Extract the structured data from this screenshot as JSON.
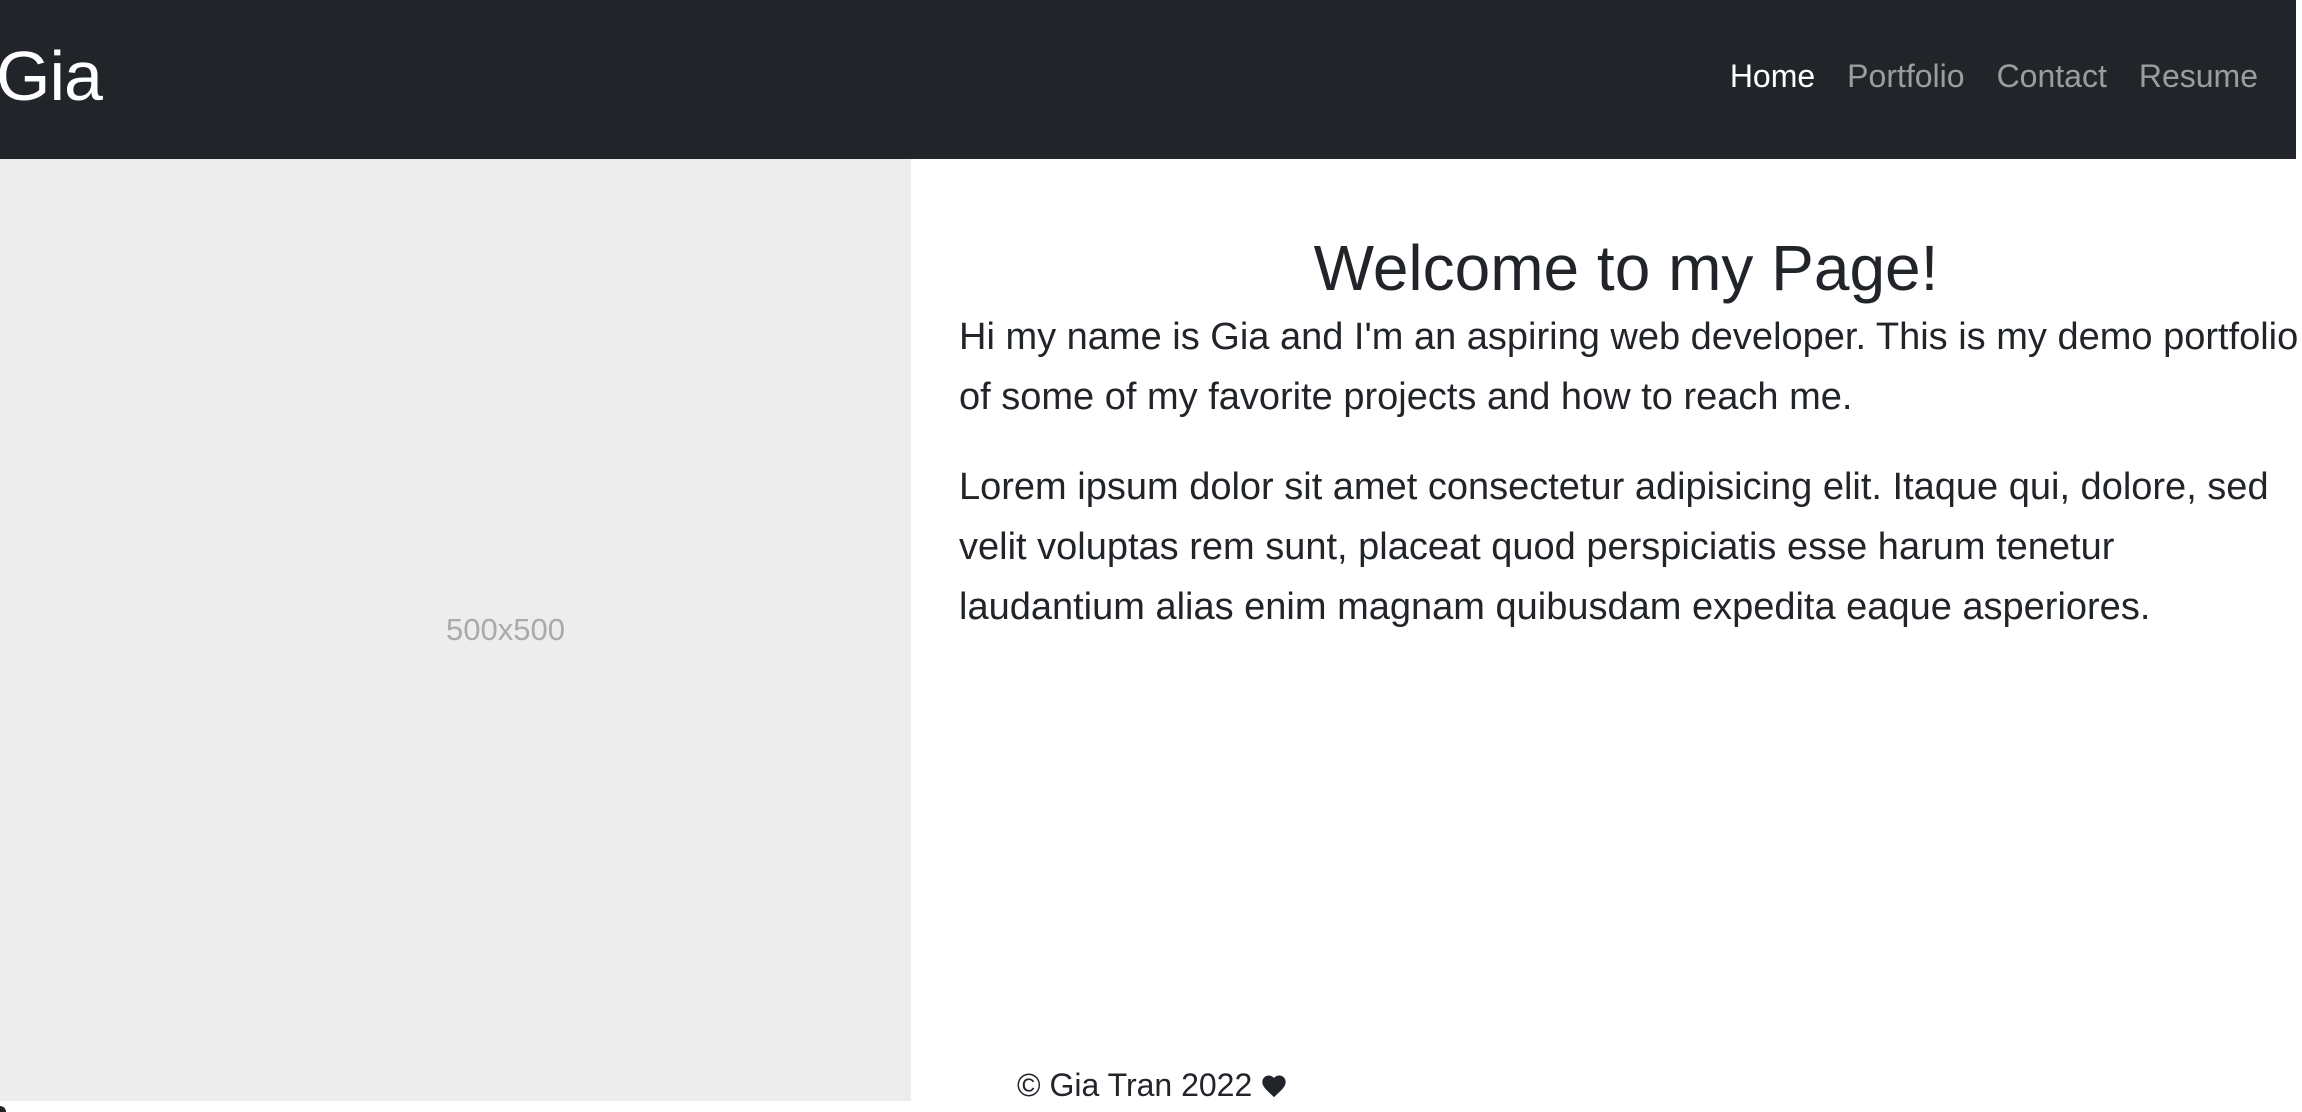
{
  "navbar": {
    "brand": "Gia",
    "links": [
      {
        "label": "Home",
        "active": true
      },
      {
        "label": "Portfolio",
        "active": false
      },
      {
        "label": "Contact",
        "active": false
      },
      {
        "label": "Resume",
        "active": false
      }
    ]
  },
  "hero_image": {
    "placeholder_text": "500x500"
  },
  "main": {
    "heading": "Welcome to my Page!",
    "intro": "Hi my name is Gia and I'm an aspiring web developer. This is my demo portfolio of some of my favorite projects and how to reach me.",
    "body": "Lorem ipsum dolor sit amet consectetur adipisicing elit. Itaque qui, dolore, sed velit voluptas rem sunt, placeat quod perspiciatis esse harum tenetur laudantium alias enim magnam quibusdam expedita eaque asperiores."
  },
  "footer": {
    "text": "© Gia Tran 2022",
    "icon": "heart-icon"
  },
  "colors": {
    "navbar_bg": "#212529",
    "nav_active": "#ffffff",
    "nav_inactive": "#8c8e90",
    "placeholder_bg": "#ededed",
    "placeholder_text": "#aaaaaa",
    "text": "#212529"
  }
}
